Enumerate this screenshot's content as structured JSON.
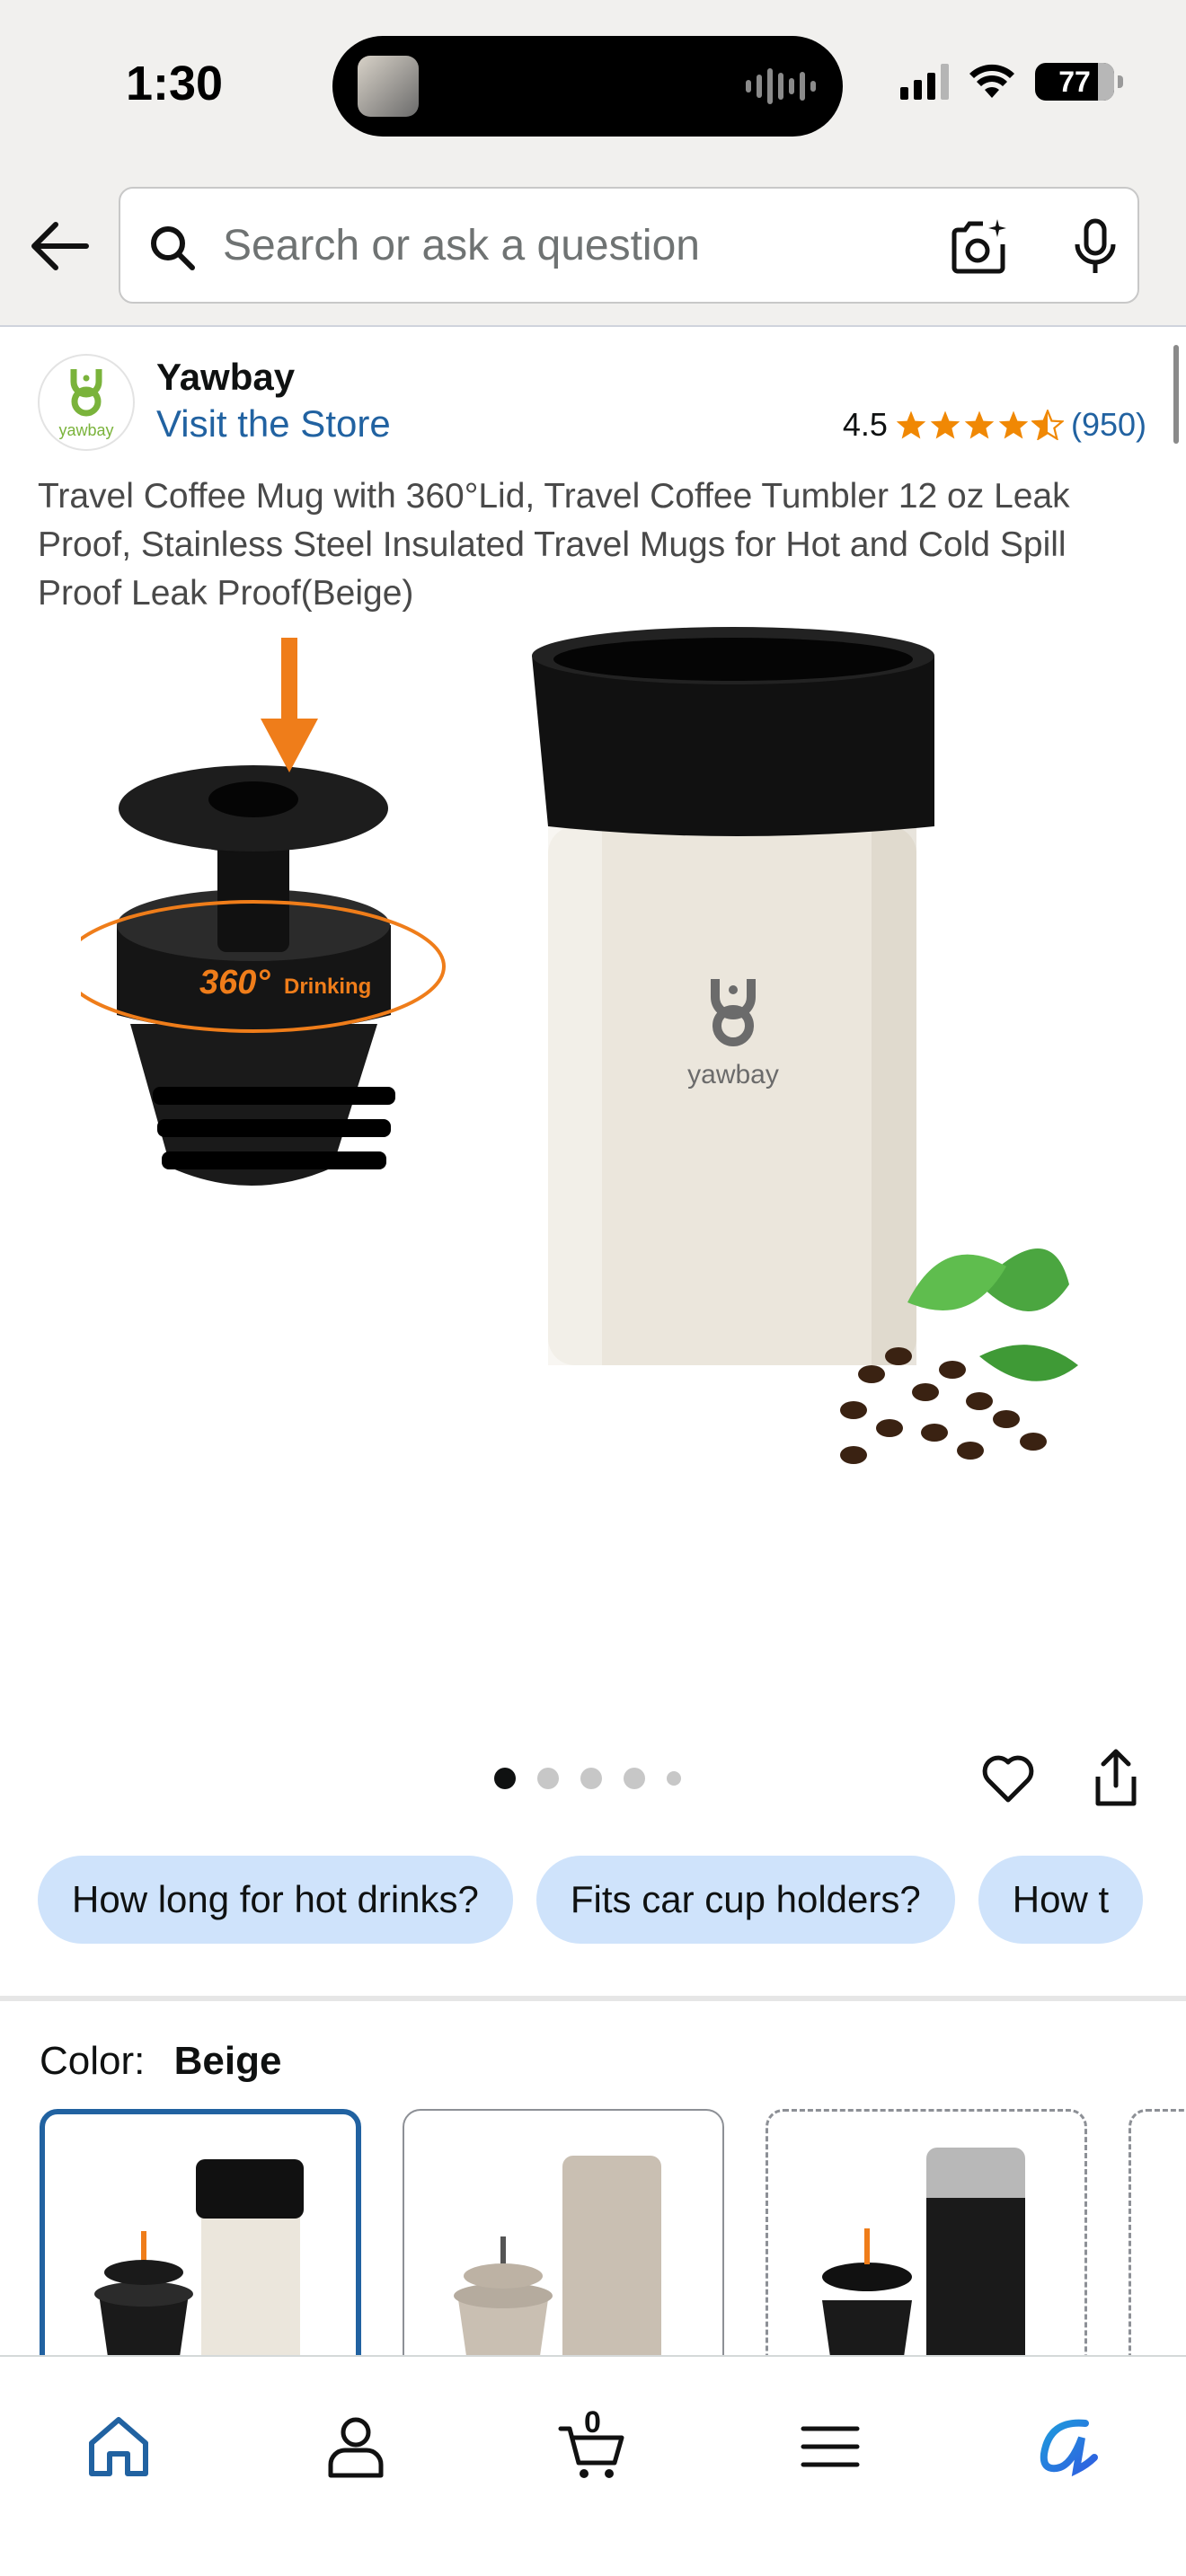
{
  "status_bar": {
    "time": "1:30",
    "battery": "77"
  },
  "search": {
    "placeholder": "Search or ask a question"
  },
  "brand": {
    "name": "Yawbay",
    "logo_text": "yawbay",
    "visit_store": "Visit the Store"
  },
  "rating": {
    "score": "4.5",
    "stars": 4.5,
    "review_count": "(950)"
  },
  "product": {
    "title": "Travel Coffee Mug with 360°Lid, Travel Coffee Tumbler 12 oz Leak Proof, Stainless Steel Insulated Travel Mugs for Hot and Cold Spill Proof Leak Proof(Beige)",
    "image_overlay": {
      "badge_number": "360°",
      "badge_text": "Drinking",
      "cup_logo": "yawbay"
    }
  },
  "carousel": {
    "total_dots": 5,
    "active_index": 0
  },
  "questions": [
    {
      "label": "How long for hot drinks?"
    },
    {
      "label": "Fits car cup holders?"
    },
    {
      "label": "How t"
    }
  ],
  "color_selector": {
    "label": "Color:",
    "selected": "Beige"
  },
  "bottom_nav": {
    "cart_count": "0"
  },
  "colors": {
    "link": "#2162a1",
    "chip": "#cfe3fb",
    "star": "#f08804",
    "rufus": "#1e9bdc"
  }
}
